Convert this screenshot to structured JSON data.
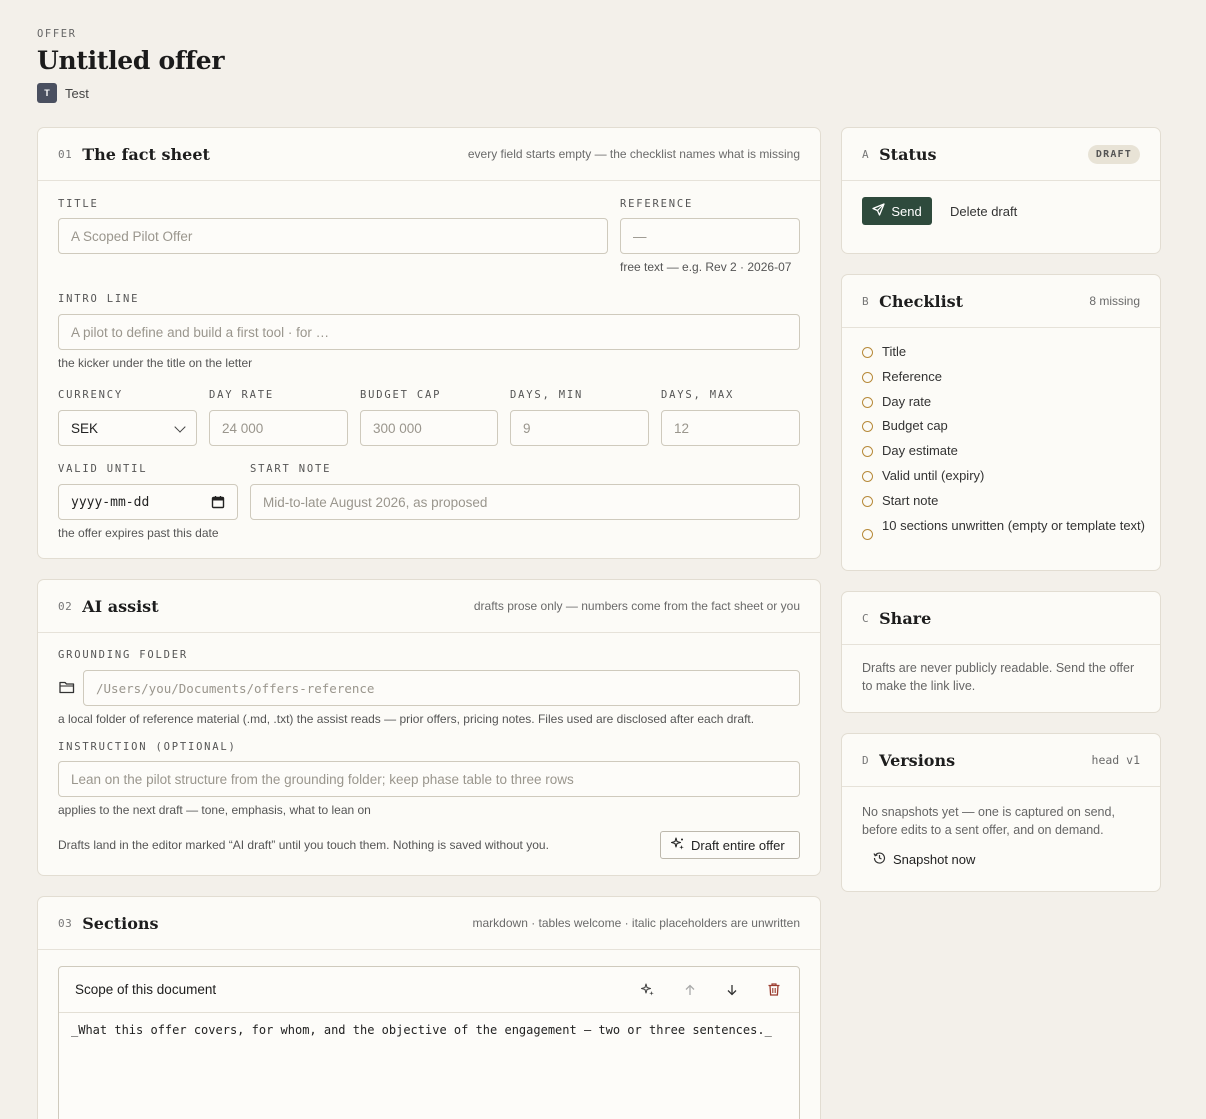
{
  "header": {
    "kicker": "OFFER",
    "title": "Untitled offer",
    "client_initial": "T",
    "client_name": "Test"
  },
  "fact_sheet": {
    "num": "01",
    "title": "The fact sheet",
    "note": "every field starts empty — the checklist names what is missing",
    "title_label": "TITLE",
    "title_placeholder": "A Scoped Pilot Offer",
    "reference_label": "REFERENCE",
    "reference_placeholder": "—",
    "reference_hint": "free text — e.g. Rev 2 · 2026-07",
    "intro_label": "INTRO LINE",
    "intro_placeholder": "A pilot to define and build a first tool · for …",
    "intro_hint": "the kicker under the title on the letter",
    "currency_label": "CURRENCY",
    "currency_value": "SEK",
    "day_rate_label": "DAY RATE",
    "day_rate_placeholder": "24 000",
    "budget_cap_label": "BUDGET CAP",
    "budget_cap_placeholder": "300 000",
    "days_min_label": "DAYS, MIN",
    "days_min_placeholder": "9",
    "days_max_label": "DAYS, MAX",
    "days_max_placeholder": "12",
    "valid_until_label": "VALID UNTIL",
    "valid_until_value": "yyyy-mm-dd",
    "valid_until_hint": "the offer expires past this date",
    "start_note_label": "START NOTE",
    "start_note_placeholder": "Mid-to-late August 2026, as proposed"
  },
  "ai_assist": {
    "num": "02",
    "title": "AI assist",
    "note": "drafts prose only — numbers come from the fact sheet or you",
    "folder_label": "GROUNDING FOLDER",
    "folder_placeholder": "/Users/you/Documents/offers-reference",
    "folder_hint": "a local folder of reference material (.md, .txt) the assist reads — prior offers, pricing notes. Files used are disclosed after each draft.",
    "instruction_label": "INSTRUCTION (OPTIONAL)",
    "instruction_placeholder": "Lean on the pilot structure from the grounding folder; keep phase table to three rows",
    "instruction_hint": "applies to the next draft — tone, emphasis, what to lean on",
    "footer_text": "Drafts land in the editor marked “AI draft” until you touch them. Nothing is saved without you.",
    "draft_button": "Draft entire offer"
  },
  "sections": {
    "num": "03",
    "title": "Sections",
    "note": "markdown · tables welcome · italic placeholders are unwritten",
    "items": [
      {
        "heading": "Scope of this document",
        "text": "_What this offer covers, for whom, and the objective of the engagement — two or three sentences._"
      }
    ]
  },
  "status": {
    "letter": "A",
    "title": "Status",
    "badge": "DRAFT",
    "send_label": "Send",
    "delete_label": "Delete draft"
  },
  "checklist": {
    "letter": "B",
    "title": "Checklist",
    "count": "8 missing",
    "items": [
      "Title",
      "Reference",
      "Day rate",
      "Budget cap",
      "Day estimate",
      "Valid until (expiry)",
      "Start note",
      "10 sections unwritten (empty or template text)"
    ]
  },
  "share": {
    "letter": "C",
    "title": "Share",
    "text": "Drafts are never publicly readable. Send the offer to make the link live."
  },
  "versions": {
    "letter": "D",
    "title": "Versions",
    "head": "head v1",
    "text": "No snapshots yet — one is captured on send, before edits to a sent offer, and on demand.",
    "snapshot_label": "Snapshot now"
  },
  "colors": {
    "background": "#f3f0ea",
    "card": "#fcfbf7",
    "accent_green": "#2e4a3c",
    "checklist_ring": "#b78a3a",
    "delete_red": "#9b3b2e"
  }
}
